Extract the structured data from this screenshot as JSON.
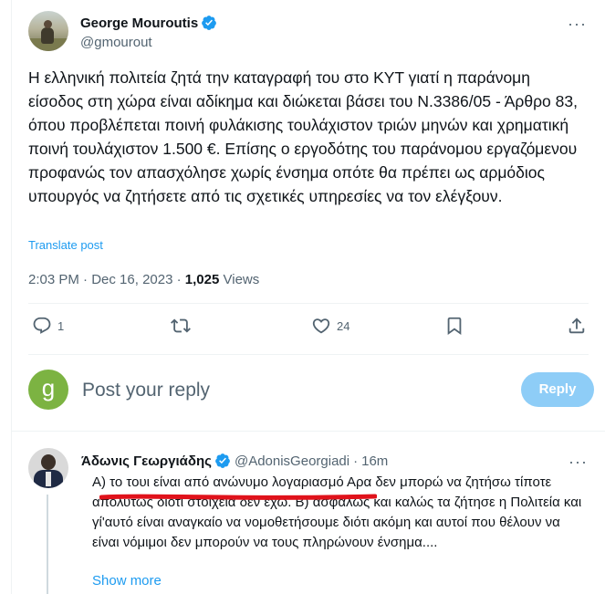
{
  "tweet": {
    "author_name": "George Mouroutis",
    "author_handle": "@gmourout",
    "text": "Η ελληνική πολιτεία ζητά την καταγραφή του στο ΚΥΤ γιατί η παράνομη είσοδος στη χώρα είναι αδίκημα και διώκεται βάσει του Ν.3386/05 - Άρθρο 83, όπου προβλέπεται ποινή φυλάκισης τουλάχιστον τριών μηνών και χρηματική ποινή τουλάχιστον 1.500 €. Επίσης ο εργοδότης του παράνομου εργαζόμενου προφανώς τον απασχόλησε χωρίς ένσημα οπότε θα πρέπει ως αρμόδιος υπουργός να ζητήσετε από τις σχετικές υπηρεσίες να τον ελέγξουν.",
    "translate_label": "Translate post",
    "time": "2:03 PM",
    "date": "Dec 16, 2023",
    "separator": "·",
    "views_count": "1,025",
    "views_label": "Views",
    "more_icon_glyph": "···"
  },
  "actions": {
    "reply_count": "1",
    "repost_count": "",
    "like_count": "24",
    "bookmark_count": "",
    "share_count": ""
  },
  "composer": {
    "avatar_letter": "g",
    "placeholder": "Post your reply",
    "button_label": "Reply"
  },
  "reply": {
    "author_name": "Άδωνις Γεωργιάδης",
    "author_handle": "@AdonisGeorgiadi",
    "separator": "·",
    "time": "16m",
    "text": "A) το τουι είναι από ανώνυμο λογαριασμό Αρα δεν μπορώ να ζητήσω τίποτε απολύτως διότι στοιχεία δεν έχω. Β) ασφαλώς και καλώς τα ζήτησε η Πολιτεία και γί'αυτό είναι αναγκαίο να νομοθετήσουμε διότι ακόμη και αυτοί που θέλουν να είναι νόμιμοι δεν μπορούν να τους πληρώνουν ένσημα....",
    "show_more_label": "Show more",
    "more_icon_glyph": "···"
  },
  "colors": {
    "accent": "#1d9bf0",
    "text_secondary": "#536471",
    "reply_button_disabled": "#8ecdf7",
    "annotation_red": "#e0121b",
    "composer_avatar": "#7cb342"
  }
}
